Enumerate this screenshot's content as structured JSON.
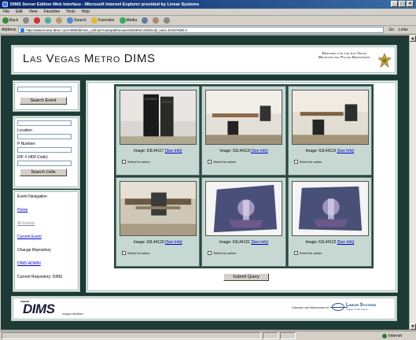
{
  "browser": {
    "title": "DIMS Server Edition Web Interface - Microsoft Internet Explorer provided by Linear Systems",
    "menu": [
      "File",
      "Edit",
      "View",
      "Favorites",
      "Tools",
      "Help"
    ],
    "toolbar": {
      "back": "Back",
      "search": "Search",
      "favorites": "Favorites",
      "media": "Media"
    },
    "address_label": "Address",
    "address": "http://www.linear-dims.com:8080/dims/x_call.isp?casepathmcase/2003/03-2302/call_num=00107648-4",
    "go": "Go",
    "links": "Links",
    "status_zone": "Internet"
  },
  "header": {
    "title": "Las Vegas Metro DIMS",
    "credit": "Designed for the Las Vegas Metropolitan Police Department"
  },
  "sidebar": {
    "search_event_button": "Search Event",
    "location_label": "Location",
    "p_number_label": "P Number:",
    "idf_label": "IDF # (400 Code)",
    "search_cells_button": "Search Cells",
    "event_navigation": "Event Navigation",
    "home": "Home",
    "all_events": "All Events",
    "current_event": "Current Event",
    "change_repository": "Change Repository",
    "dims_admin": "DIMS ADMIN",
    "current_repository": "Current Repository: DIMS"
  },
  "images": [
    {
      "label": "Image: 63L44117",
      "see_info": "[See Info]",
      "select": "Select for action",
      "scene": "cabinets"
    },
    {
      "label": "Image: 63L44118",
      "see_info": "[See Info]",
      "select": "Select for action",
      "scene": "office"
    },
    {
      "label": "Image: 63L44119",
      "see_info": "[See Info]",
      "select": "Select for action",
      "scene": "office"
    },
    {
      "label": "Image: 63L44120",
      "see_info": "[See Info]",
      "select": "Select for action",
      "scene": "workshop"
    },
    {
      "label": "Image: 63L44121",
      "see_info": "[See Info]",
      "select": "Select for action",
      "scene": "art"
    },
    {
      "label": "Image: 63L44122",
      "see_info": "[See Info]",
      "select": "Select for action",
      "scene": "art"
    }
  ],
  "submit_button": "Submit Query",
  "footer": {
    "logo": "DIMS",
    "trademark": "Trademark",
    "sub": "Imaged Identities",
    "created_by": "Created and Maintained by",
    "company": "Linear Systems",
    "tagline": "Images of the Future"
  }
}
